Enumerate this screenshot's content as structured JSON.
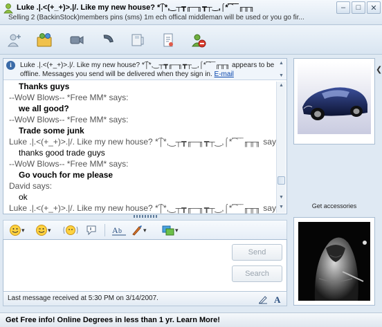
{
  "window": {
    "title": "Luke .|.<(+_+)>.|/. Like my new house? *͡⌠*,‿┬┳╓─╖┳┬‿,⌠*͡‾‾‾‾╓╥╖",
    "subtitle": "Selling 2 (BackinStock)members pins (sms) 1m ech offical middleman will be used or you go fir...",
    "controls": {
      "minimize": "–",
      "maximize": "□",
      "close": "✕"
    }
  },
  "toolbar": {
    "icons": [
      "invite-contact-icon",
      "send-files-icon",
      "video-icon",
      "call-icon",
      "games-icon",
      "activities-icon",
      "block-icon"
    ]
  },
  "infobar": {
    "icon_glyph": "i",
    "text": "Luke .|.<(+_+)>.|/. Like my new house? *͡⌠*,‿┬┳╓─╖┳┬‿,⌠*͡‾‾‾‾╓╥╖ appears to be offline. Messages you send will be delivered when they sign in.",
    "link": "E-mail"
  },
  "messages": [
    {
      "kind": "bold",
      "text": "Thanks guys"
    },
    {
      "kind": "says",
      "text": "--WoW Blows-- *Free MM* says:"
    },
    {
      "kind": "bold",
      "text": "we all good?"
    },
    {
      "kind": "says",
      "text": "--WoW Blows-- *Free MM* says:"
    },
    {
      "kind": "bold",
      "text": "Trade some junk"
    },
    {
      "kind": "says",
      "text": "Luke .|.<(+_+)>.|/. Like my new house? *͡⌠*,‿┬┳╓─╖┳┬‿,⌠*͡‾‾‾‾╓╥╖ says:"
    },
    {
      "kind": "plain",
      "text": "thanks good trade guys"
    },
    {
      "kind": "says",
      "text": "--WoW Blows-- *Free MM* says:"
    },
    {
      "kind": "bold",
      "text": "Go vouch for me please"
    },
    {
      "kind": "says",
      "text": "David says:"
    },
    {
      "kind": "plain",
      "text": "ok"
    },
    {
      "kind": "says",
      "text": "Luke .|.<(+_+)>.|/. Like my new house? *͡⌠*,‿┬┳╓─╖┳┬‿,⌠*͡‾‾‾‾╓╥╖ says:"
    }
  ],
  "formatbar": {
    "tools": [
      "emoticon-icon",
      "wink-icon",
      "nudge-icon",
      "voice-clip-icon",
      "font-icon",
      "background-icon",
      "ink-icon"
    ]
  },
  "compose": {
    "value": "",
    "send_label": "Send",
    "search_label": "Search"
  },
  "status": {
    "text": "Last message received at 5:30 PM on 3/14/2007."
  },
  "side": {
    "get_accessories": "Get accessories",
    "collapse_arrow": "❮"
  },
  "ad": {
    "text": "Get Free info! Online Degrees in less than 1 yr. Learn More!"
  },
  "colors": {
    "link": "#0645ad",
    "frame": "#a7bcd2",
    "chrome": "#dfe9f3"
  }
}
